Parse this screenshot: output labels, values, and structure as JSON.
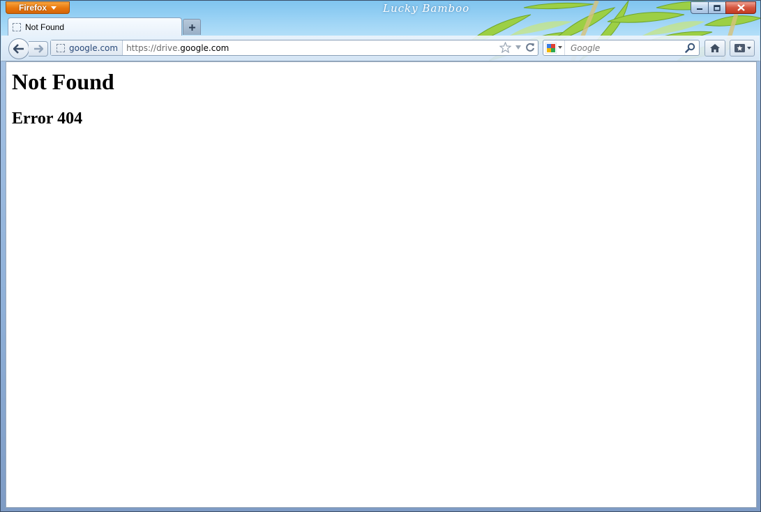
{
  "browser": {
    "menu_button_label": "Firefox",
    "theme_title": "Lucky Bamboo"
  },
  "tabs": [
    {
      "label": "Not Found"
    }
  ],
  "navbar": {
    "identity_label": "google.com",
    "url_prefix": "https://drive.",
    "url_host": "google.com",
    "search_placeholder": "Google"
  },
  "page": {
    "heading": "Not Found",
    "subheading": "Error 404"
  },
  "icons": {
    "back": "back-arrow-icon",
    "forward": "forward-arrow-icon",
    "bookmark_star": "star-icon",
    "history_dropdown": "dropdown-arrow-icon",
    "reload": "reload-icon",
    "search_engine": "google-icon",
    "search": "magnifier-icon",
    "home": "home-icon",
    "bookmarks": "bookmarks-icon"
  },
  "colors": {
    "firefox_button": "#e8760c",
    "close_button": "#c23a21",
    "url_identity_text": "#2a4a7a"
  }
}
